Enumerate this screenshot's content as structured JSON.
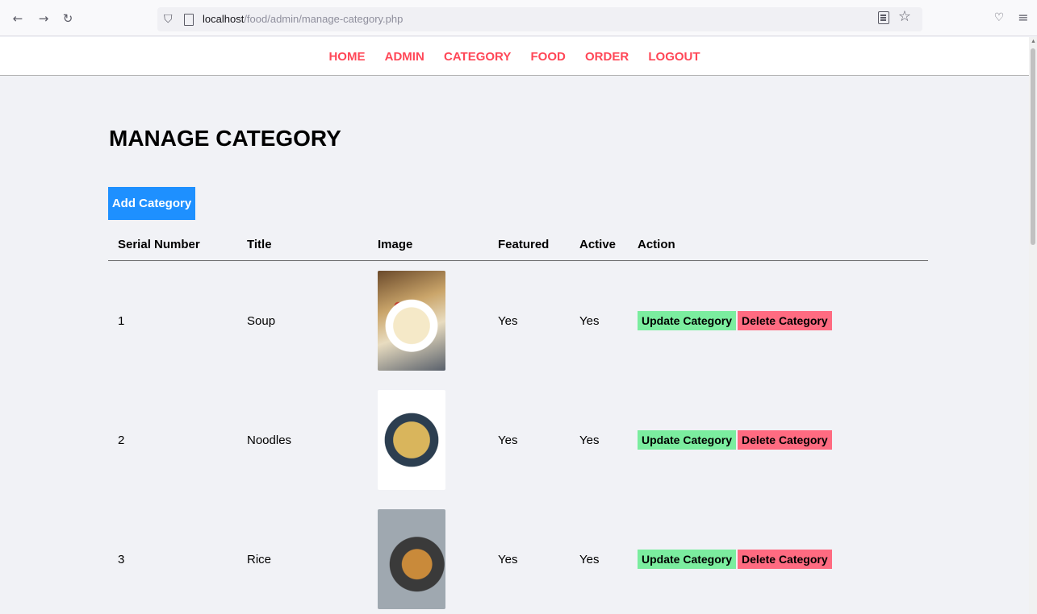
{
  "browser": {
    "url_host": "localhost",
    "url_path": "/food/admin/manage-category.php"
  },
  "menu": [
    {
      "label": "HOME"
    },
    {
      "label": "ADMIN"
    },
    {
      "label": "CATEGORY"
    },
    {
      "label": "FOOD"
    },
    {
      "label": "ORDER"
    },
    {
      "label": "LOGOUT"
    }
  ],
  "page": {
    "title": "MANAGE CATEGORY",
    "add_button": "Add Category"
  },
  "table": {
    "headers": [
      "Serial Number",
      "Title",
      "Image",
      "Featured",
      "Active",
      "Action"
    ],
    "rows": [
      {
        "serial": "1",
        "title": "Soup",
        "featured": "Yes",
        "active": "Yes",
        "update": "Update Category",
        "delete": "Delete Category"
      },
      {
        "serial": "2",
        "title": "Noodles",
        "featured": "Yes",
        "active": "Yes",
        "update": "Update Category",
        "delete": "Delete Category"
      },
      {
        "serial": "3",
        "title": "Rice",
        "featured": "Yes",
        "active": "Yes",
        "update": "Update Category",
        "delete": "Delete Category"
      }
    ]
  },
  "colors": {
    "menu_link": "#ff4757",
    "add_button": "#1e90ff",
    "update_button": "#7bed9f",
    "delete_button": "#ff6b81",
    "page_bg": "#f1f2f6"
  }
}
